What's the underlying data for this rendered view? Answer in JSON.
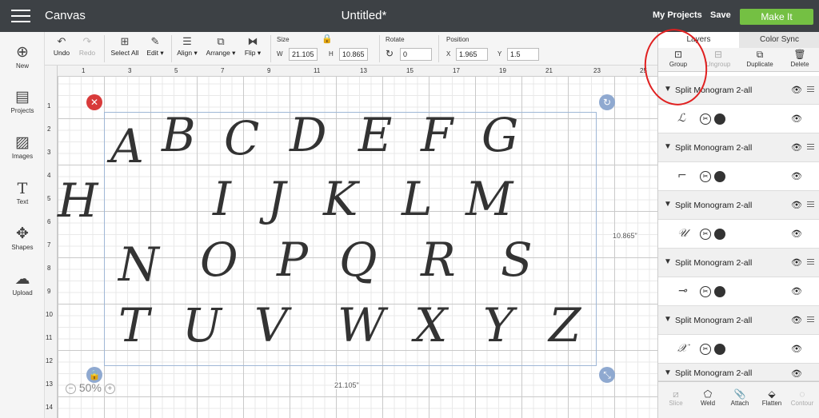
{
  "topbar": {
    "app": "Canvas",
    "doc_title": "Untitled*",
    "my_projects": "My Projects",
    "save": "Save",
    "make_it": "Make It"
  },
  "toolbar": {
    "undo": "Undo",
    "redo": "Redo",
    "select_all": "Select All",
    "edit": "Edit ▾",
    "align": "Align ▾",
    "arrange": "Arrange ▾",
    "flip": "Flip ▾",
    "size_label": "Size",
    "w_label": "W",
    "w_value": "21.105",
    "h_label": "H",
    "h_value": "10.865",
    "rotate_label": "Rotate",
    "rotate_value": "0",
    "position_label": "Position",
    "x_label": "X",
    "x_value": "1.965",
    "y_label": "Y",
    "y_value": "1.5"
  },
  "leftnav": {
    "new": "New",
    "projects": "Projects",
    "images": "Images",
    "text": "Text",
    "shapes": "Shapes",
    "upload": "Upload"
  },
  "ruler": {
    "top": [
      "1",
      "3",
      "5",
      "7",
      "9",
      "11",
      "13",
      "15",
      "17",
      "19",
      "21",
      "23",
      "25"
    ],
    "left": [
      "1",
      "2",
      "3",
      "4",
      "5",
      "6",
      "7",
      "8",
      "9",
      "10",
      "11",
      "12",
      "13",
      "14"
    ]
  },
  "canvas": {
    "width_label": "21.105\"",
    "height_label": "10.865\"",
    "zoom": "50%",
    "row1": [
      "A",
      "B",
      "C",
      "D",
      "E",
      "F",
      "G"
    ],
    "row2": [
      "I",
      "J",
      "K",
      "L",
      "M"
    ],
    "row3": [
      "N",
      "O",
      "P",
      "Q",
      "R",
      "S"
    ],
    "row4": [
      "T",
      "U",
      "V",
      "W",
      "X",
      "Y",
      "Z"
    ],
    "stray": "H"
  },
  "panel": {
    "tab_layers": "Layers",
    "tab_color_sync": "Color Sync",
    "group": "Group",
    "ungroup": "Ungroup",
    "duplicate": "Duplicate",
    "delete": "Delete",
    "groups": [
      {
        "name": "Split Monogram 2-all",
        "thumb": "ℒ"
      },
      {
        "name": "Split Monogram 2-all",
        "thumb": "⌐"
      },
      {
        "name": "Split Monogram 2-all",
        "thumb": "𝒰"
      },
      {
        "name": "Split Monogram 2-all",
        "thumb": "⊸"
      },
      {
        "name": "Split Monogram 2-all",
        "thumb": "𝒳"
      },
      {
        "name": "Split Monogram 2-all"
      }
    ],
    "bottom": {
      "slice": "Slice",
      "weld": "Weld",
      "attach": "Attach",
      "flatten": "Flatten",
      "contour": "Contour"
    }
  },
  "colors": {
    "topbar": "#3d4145",
    "make_it": "#74c043",
    "annotation": "#e02020"
  }
}
